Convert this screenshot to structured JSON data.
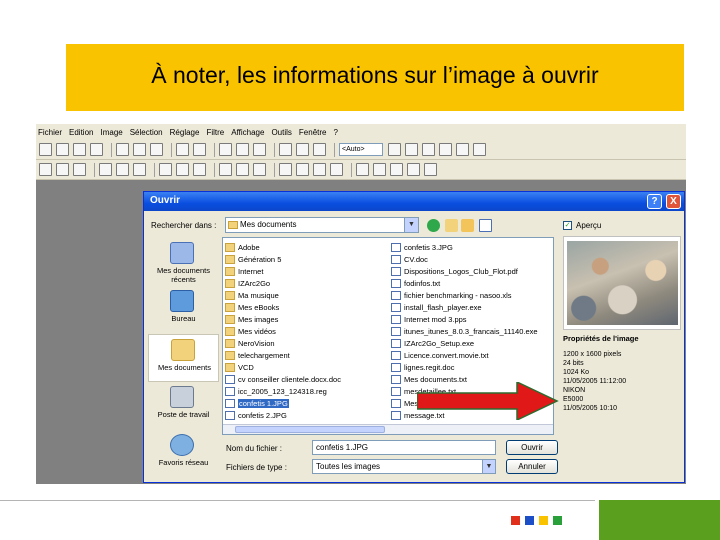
{
  "slide": {
    "title": "À noter, les informations sur l’image à ouvrir",
    "colors": {
      "title_band": "#f9c300",
      "arrow": "#e01818",
      "footer_panel": "#5aa01e",
      "footer_squares": [
        "#e0301c",
        "#1c4ec8",
        "#f9c300",
        "#2aa03a"
      ]
    }
  },
  "app": {
    "menu": [
      "Fichier",
      "Edition",
      "Image",
      "Sélection",
      "Réglage",
      "Filtre",
      "Affichage",
      "Outils",
      "Fenêtre",
      "?"
    ],
    "zoom_value": "<Auto>"
  },
  "dialog": {
    "title": "Ouvrir",
    "help_glyph": "?",
    "close_glyph": "X",
    "look_in_label": "Rechercher dans :",
    "look_in_value": "Mes documents",
    "places": [
      "Mes documents récents",
      "Bureau",
      "Mes documents",
      "Poste de travail",
      "Favoris réseau"
    ],
    "files_left": [
      {
        "name": "Adobe",
        "type": "folder"
      },
      {
        "name": "Génération 5",
        "type": "folder"
      },
      {
        "name": "Internet",
        "type": "folder"
      },
      {
        "name": "IZArc2Go",
        "type": "folder"
      },
      {
        "name": "Ma musique",
        "type": "folder"
      },
      {
        "name": "Mes eBooks",
        "type": "folder"
      },
      {
        "name": "Mes images",
        "type": "folder"
      },
      {
        "name": "Mes vidéos",
        "type": "folder"
      },
      {
        "name": "NeroVision",
        "type": "folder"
      },
      {
        "name": "telechargement",
        "type": "folder"
      },
      {
        "name": "VCD",
        "type": "folder"
      },
      {
        "name": "cv conseiller clientele.docx.doc",
        "type": "doc"
      },
      {
        "name": "icc_2005_123_124318.reg",
        "type": "doc"
      },
      {
        "name": "confetis 1.JPG",
        "type": "doc",
        "selected": true
      },
      {
        "name": "confetis 2.JPG",
        "type": "doc"
      }
    ],
    "files_right": [
      {
        "name": "confetis 3.JPG",
        "type": "doc"
      },
      {
        "name": "CV.doc",
        "type": "doc"
      },
      {
        "name": "Dispositions_Logos_Club_Flot.pdf",
        "type": "doc"
      },
      {
        "name": "fodinfos.txt",
        "type": "doc"
      },
      {
        "name": "fichier benchmarking - nasoo.xls",
        "type": "doc"
      },
      {
        "name": "install_flash_player.exe",
        "type": "doc"
      },
      {
        "name": "Internet mod 3.pps",
        "type": "doc"
      },
      {
        "name": "itunes_itunes_8.0.3_francais_11140.exe",
        "type": "doc"
      },
      {
        "name": "IZArc2Go_Setup.exe",
        "type": "doc"
      },
      {
        "name": "Licence.convert.movie.txt",
        "type": "doc"
      },
      {
        "name": "lignes.regit.doc",
        "type": "doc"
      },
      {
        "name": "Mes documents.txt",
        "type": "doc"
      },
      {
        "name": "mesdetaillee.txt",
        "type": "doc"
      },
      {
        "name": "Mes documents",
        "type": "doc"
      },
      {
        "name": "message.txt",
        "type": "doc"
      }
    ],
    "preview_label": "Aperçu",
    "properties_title": "Propriétés de l'image",
    "properties": [
      "1200 x 1600 pixels",
      "24 bits",
      "1024 Ko",
      "11/05/2005 11:12:00",
      "",
      "NIKON",
      "E5000",
      "11/05/2005 10:10"
    ],
    "filename_label": "Nom du fichier :",
    "filename_value": "confetis 1.JPG",
    "filetype_label": "Fichiers de type :",
    "filetype_value": "Toutes les images",
    "open_label": "Ouvrir",
    "cancel_label": "Annuler",
    "dropdown_glyph": "▼",
    "check_glyph": "✓"
  }
}
